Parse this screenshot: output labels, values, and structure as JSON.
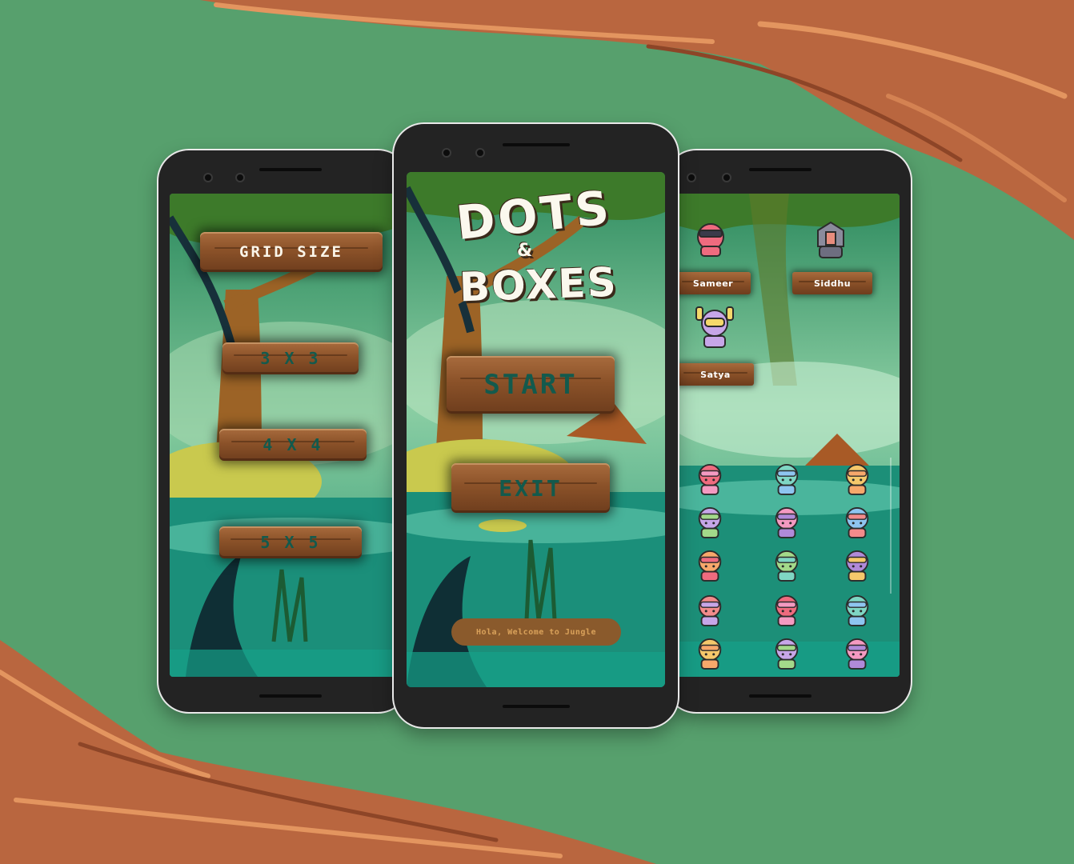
{
  "colors": {
    "background": "#57a06d",
    "branch": "#b9663f",
    "phone_body": "#232323",
    "plank": "#8b5229",
    "plank_text_white": "#fbf6ea",
    "plank_text_teal": "#135a4d"
  },
  "grid_screen": {
    "title": "GRID SIZE",
    "options": [
      "3 X 3",
      "4 X 4",
      "5 X 5"
    ]
  },
  "home_screen": {
    "logo_line1": "DOTS",
    "logo_amp": "&",
    "logo_line2": "BOXES",
    "start_label": "START",
    "exit_label": "EXIT",
    "welcome_text": "Hola, Welcome to Jungle"
  },
  "player_screen": {
    "players": [
      "Sameer",
      "Siddhu",
      "Satya"
    ],
    "player_avatars": [
      "ninja-avatar-icon",
      "knight-avatar-icon",
      "astronaut-avatar-icon"
    ],
    "avatar_grid": [
      "shield-hero-avatar-icon",
      "dragon-avatar-icon",
      "viking-avatar-icon",
      "pilot-avatar-icon",
      "ninja-mask-avatar-icon",
      "bandana-avatar-icon",
      "spiky-hair-avatar-icon",
      "goggles-avatar-icon",
      "cat-mask-avatar-icon",
      "elf-avatar-icon",
      "red-ninja-avatar-icon",
      "alien-avatar-icon",
      "masked-avatar-icon",
      "shark-avatar-icon",
      "red-monster-avatar-icon"
    ]
  }
}
